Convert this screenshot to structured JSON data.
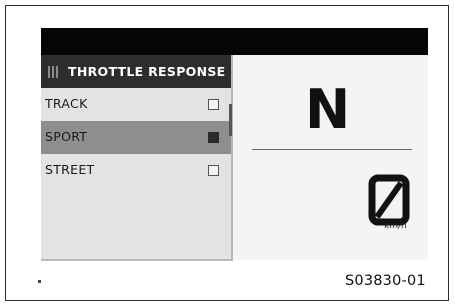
{
  "menu": {
    "title": "THROTTLE RESPONSE",
    "items": [
      {
        "label": "TRACK",
        "checked": false
      },
      {
        "label": "SPORT",
        "checked": true
      },
      {
        "label": "STREET",
        "checked": false
      }
    ]
  },
  "dashboard": {
    "gear": "N",
    "speed": "0",
    "speed_unit": "km/h"
  },
  "figure_code": "S03830-01",
  "icons": {
    "grip": "grip-icon",
    "checkbox": "checkbox-icon",
    "zero_digit": "slashed-zero"
  },
  "colors": {
    "topbar": "#050505",
    "menu_header": "#2d2d2d",
    "menu_bg": "#e3e3e3",
    "selected_row": "#8e8e8e",
    "screen_bg": "#f4f4f4"
  }
}
